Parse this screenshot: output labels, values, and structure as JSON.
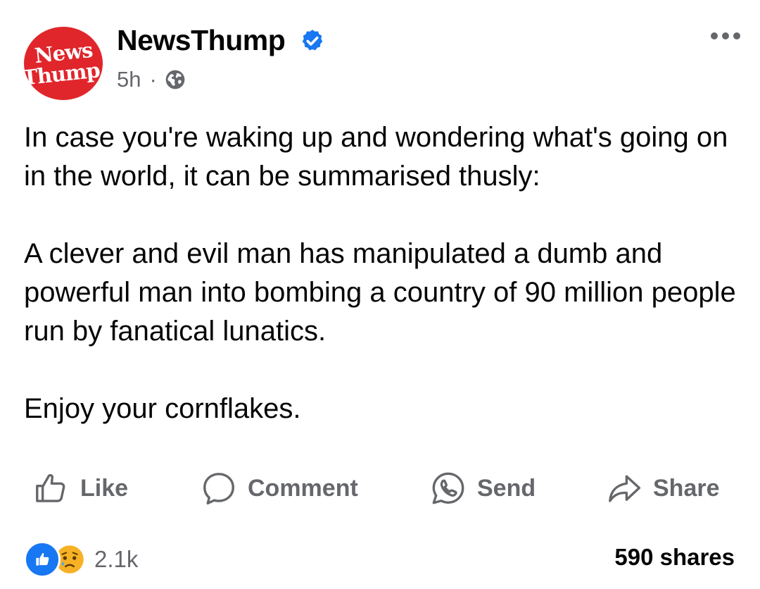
{
  "post": {
    "avatar_text": [
      "News",
      "Thump"
    ],
    "page_name": "NewsThump",
    "time": "5h",
    "meta_separator": "·",
    "paragraphs": [
      "In case you're waking up and wondering what's going on in the world, it can be summarised thusly:",
      "A clever and evil man has manipulated a dumb and powerful man into bombing a country of 90 million people run by fanatical lunatics.",
      "Enjoy your cornflakes."
    ]
  },
  "actions": {
    "like": "Like",
    "comment": "Comment",
    "send": "Send",
    "share": "Share"
  },
  "footer": {
    "reaction_count": "2.1k",
    "shares": "590 shares"
  },
  "colors": {
    "avatar_red": "#e0262b",
    "verified_blue": "#1877f2",
    "muted_gray": "#65676b"
  },
  "icons": [
    "verified-badge-icon",
    "globe-icon",
    "more-options-icon",
    "like-icon",
    "comment-icon",
    "send-icon",
    "share-icon",
    "like-reaction-icon",
    "sad-reaction-icon"
  ]
}
